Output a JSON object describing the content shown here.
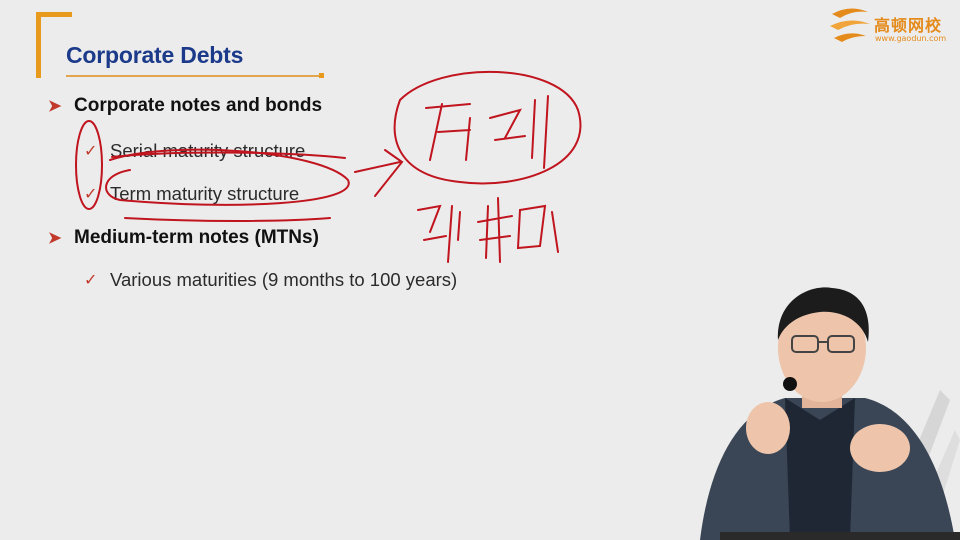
{
  "slide": {
    "title": "Corporate Debts",
    "bullets": [
      {
        "text": "Corporate notes and bonds",
        "sub": [
          "Serial maturity structure",
          "Term maturity structure"
        ]
      },
      {
        "text": "Medium-term notes (MTNs)",
        "sub": [
          "Various maturities (9 months to 100 years)"
        ]
      }
    ]
  },
  "logo": {
    "name": "高顿网校",
    "url": "www.gaodun.com"
  },
  "icons": {
    "level1": "arrowhead-bullet-icon",
    "level2": "checkmark-bullet-icon"
  },
  "colors": {
    "title": "#1b3a8a",
    "accent_orange": "#e79a1c",
    "bullet_red": "#c0392b",
    "ink_red": "#c0141e",
    "background": "#ececec"
  }
}
